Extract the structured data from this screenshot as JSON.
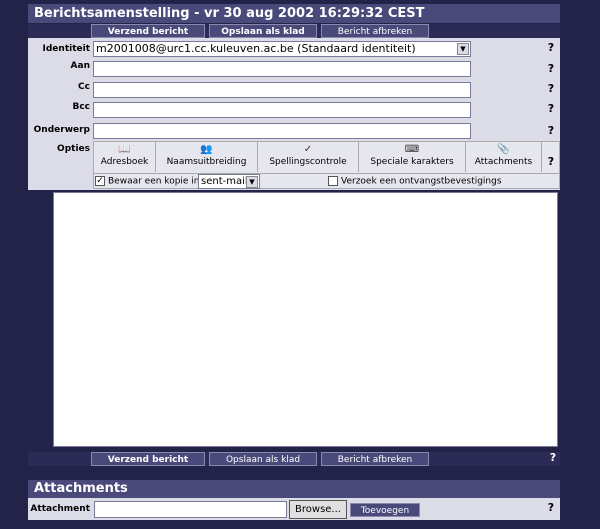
{
  "title": "Berichtsamenstelling - vr 30 aug 2002 16:29:32 CEST",
  "buttons": {
    "send": "Verzend bericht",
    "draft": "Opslaan als klad",
    "cancel": "Bericht afbreken"
  },
  "help_glyph": "?",
  "fields": {
    "identity": {
      "label": "Identiteit",
      "value": "m2001008@urc1.cc.kuleuven.ac.be (Standaard identiteit)"
    },
    "to": {
      "label": "Aan",
      "value": ""
    },
    "cc": {
      "label": "Cc",
      "value": ""
    },
    "bcc": {
      "label": "Bcc",
      "value": ""
    },
    "subject": {
      "label": "Onderwerp",
      "value": ""
    }
  },
  "options": {
    "label": "Opties",
    "items": [
      "Adresboek",
      "Naamsuitbreiding",
      "Spellingscontrole",
      "Speciale karakters",
      "Attachments"
    ],
    "icons": [
      "address-book-icon",
      "name-expansion-icon",
      "spellcheck-icon",
      "special-characters-icon",
      "paperclip-icon"
    ],
    "keep_copy": "Bewaar een kopie in",
    "folder": "sent-mail",
    "receipt": "Verzoek een ontvangstbevestigings"
  },
  "attachments": {
    "title": "Attachments",
    "label": "Attachment",
    "browse": "Browse...",
    "add": "Toevoegen"
  }
}
